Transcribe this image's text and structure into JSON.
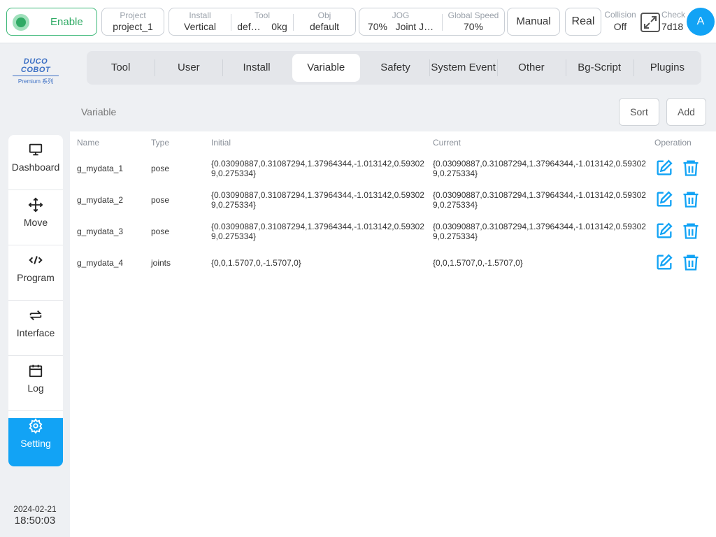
{
  "topbar": {
    "enable_label": "Enable",
    "project": {
      "caption": "Project",
      "value": "project_1"
    },
    "install": {
      "caption": "Install",
      "value": "Vertical"
    },
    "tool": {
      "caption": "Tool",
      "value": "def…",
      "weight": "0kg"
    },
    "obj": {
      "caption": "Obj",
      "value": "default"
    },
    "jog": {
      "caption": "JOG",
      "percent": "70%",
      "mode": "Joint J…"
    },
    "global_speed": {
      "caption": "Global Speed",
      "value": "70%"
    },
    "manual_label": "Manual",
    "real_label": "Real",
    "collision": {
      "caption": "Collision",
      "value": "Off"
    },
    "check": {
      "caption": "Check",
      "value": "7d18"
    },
    "avatar_letter": "A"
  },
  "logo": {
    "main": "DUCO COBOT",
    "sub": "Premium 系列"
  },
  "sidebar": {
    "items": [
      {
        "label": "Dashboard",
        "icon": "monitor-icon"
      },
      {
        "label": "Move",
        "icon": "move-icon"
      },
      {
        "label": "Program",
        "icon": "code-icon"
      },
      {
        "label": "Interface",
        "icon": "swap-icon"
      },
      {
        "label": "Log",
        "icon": "calendar-icon"
      },
      {
        "label": "Setting",
        "icon": "gear-icon",
        "active": true
      }
    ],
    "date": "2024-02-21",
    "time": "18:50:03"
  },
  "tabs": [
    "Tool",
    "User",
    "Install",
    "Variable",
    "Safety",
    "System Event",
    "Other",
    "Bg-Script",
    "Plugins"
  ],
  "active_tab": "Variable",
  "section": {
    "title": "Variable",
    "sort_label": "Sort",
    "add_label": "Add"
  },
  "table": {
    "headers": [
      "Name",
      "Type",
      "Initial",
      "Current",
      "Operation"
    ],
    "rows": [
      {
        "name": "g_mydata_1",
        "type": "pose",
        "initial": "{0.03090887,0.31087294,1.37964344,-1.013142,0.593029,0.275334}",
        "current": "{0.03090887,0.31087294,1.37964344,-1.013142,0.593029,0.275334}"
      },
      {
        "name": "g_mydata_2",
        "type": "pose",
        "initial": "{0.03090887,0.31087294,1.37964344,-1.013142,0.593029,0.275334}",
        "current": "{0.03090887,0.31087294,1.37964344,-1.013142,0.593029,0.275334}"
      },
      {
        "name": "g_mydata_3",
        "type": "pose",
        "initial": "{0.03090887,0.31087294,1.37964344,-1.013142,0.593029,0.275334}",
        "current": "{0.03090887,0.31087294,1.37964344,-1.013142,0.593029,0.275334}"
      },
      {
        "name": "g_mydata_4",
        "type": "joints",
        "initial": "{0,0,1.5707,0,-1.5707,0}",
        "current": "{0,0,1.5707,0,-1.5707,0}"
      }
    ]
  },
  "colors": {
    "accent": "#12a3f5",
    "enable": "#2faa64"
  }
}
